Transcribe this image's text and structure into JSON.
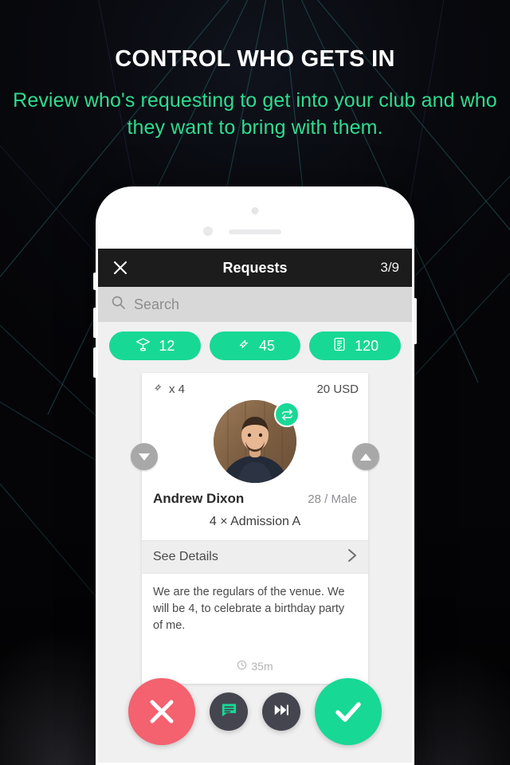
{
  "promo": {
    "headline": "CONTROL WHO GETS IN",
    "subhead": "Review who's requesting to get into your club and who they want to bring with them.",
    "accent_green": "#2fdc8f",
    "background_color": "#07070b"
  },
  "app": {
    "navbar": {
      "close_icon": "close-icon",
      "title": "Requests",
      "counter": "3/9",
      "background_color": "#1c1c1c"
    },
    "search": {
      "icon": "search-icon",
      "placeholder": "Search",
      "value": ""
    },
    "filters": [
      {
        "icon": "table-icon",
        "count": "12"
      },
      {
        "icon": "ticket-icon",
        "count": "45"
      },
      {
        "icon": "guestlist-icon",
        "count": "120"
      }
    ],
    "card": {
      "ticket_icon": "ticket-icon",
      "quantity": "x 4",
      "price": "20 USD",
      "badge_icon": "repeat-icon",
      "guest_name": "Andrew Dixon",
      "guest_meta": "28 / Male",
      "admission": "4 × Admission A",
      "see_details_label": "See Details",
      "chevron_icon": "chevron-right-icon",
      "note": "We are the regulars of the venue. We will be 4, to celebrate a birthday party of me.",
      "clock_icon": "clock-icon",
      "time_ago": "35m"
    },
    "card_nav": {
      "prev_icon": "triangle-down-icon",
      "next_icon": "triangle-up-icon"
    },
    "actions": [
      {
        "name": "reject-button",
        "icon": "x-icon",
        "color": "#f4616f"
      },
      {
        "name": "message-button",
        "icon": "chat-icon",
        "color": "#454550"
      },
      {
        "name": "skip-button",
        "icon": "skip-forward-icon",
        "color": "#454550"
      },
      {
        "name": "accept-button",
        "icon": "check-icon",
        "color": "#18d896"
      }
    ]
  }
}
